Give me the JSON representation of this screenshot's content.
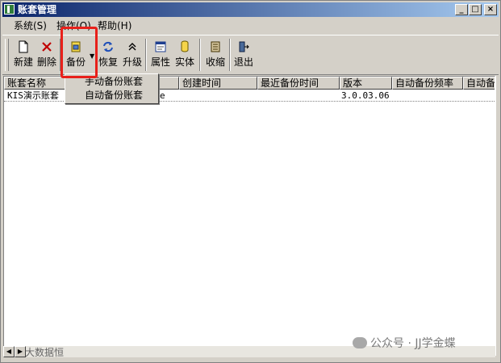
{
  "window": {
    "title": "账套管理"
  },
  "menu": {
    "items": [
      "系统(S)",
      "操作(O)",
      "帮助(H)"
    ]
  },
  "toolbar": {
    "items": [
      {
        "label": "新建",
        "icon": "new-icon"
      },
      {
        "label": "删除",
        "icon": "delete-icon"
      },
      {
        "label": "备份",
        "icon": "backup-icon"
      },
      {
        "label": "恢复",
        "icon": "restore-icon"
      },
      {
        "label": "升级",
        "icon": "upgrade-icon"
      },
      {
        "label": "属性",
        "icon": "properties-icon"
      },
      {
        "label": "实体",
        "icon": "entity-icon"
      },
      {
        "label": "收缩",
        "icon": "shrink-icon"
      },
      {
        "label": "退出",
        "icon": "exit-icon"
      }
    ]
  },
  "backup_menu": {
    "items": [
      "手动备份账套",
      "自动备份账套"
    ]
  },
  "table": {
    "columns": [
      "账套名称",
      "",
      "创建时间",
      "最近备份时间",
      "版本",
      "自动备份频率",
      "自动备"
    ],
    "rows": [
      {
        "name": "KIS演示账套",
        "db": "e",
        "created": "",
        "last_backup": "",
        "version": "3.0.03.06",
        "freq": ""
      }
    ]
  },
  "status": {
    "text": "大数据恒"
  },
  "watermark": {
    "text": "公众号 · JJ学金蝶"
  },
  "colors": {
    "highlight": "#e8201a",
    "title_start": "#0a246a",
    "title_end": "#a6caf0"
  }
}
